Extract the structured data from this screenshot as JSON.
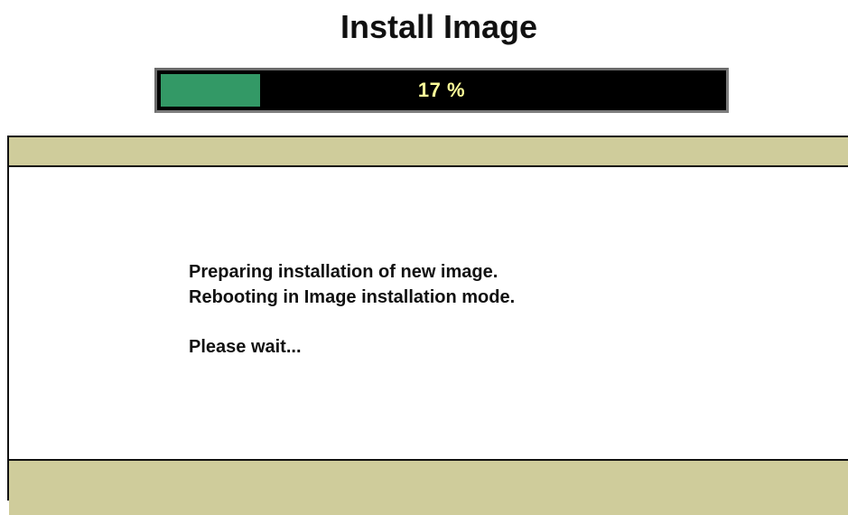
{
  "header": {
    "title": "Install Image"
  },
  "progress": {
    "percent": 17,
    "label": "17 %",
    "fill_color": "#339966",
    "track_color": "#000000",
    "text_color": "#ffff99"
  },
  "panel": {
    "band_color": "#cfcc9b",
    "message_lines": [
      "Preparing installation of new image.",
      "Rebooting in Image installation mode."
    ],
    "wait_text": "Please wait..."
  }
}
